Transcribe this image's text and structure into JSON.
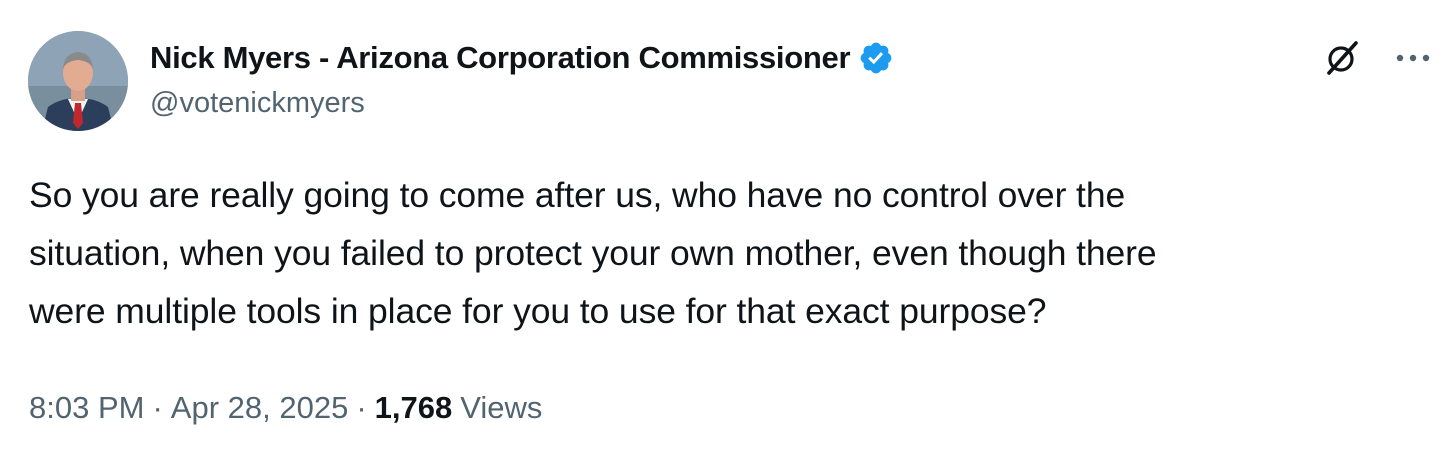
{
  "author": {
    "display_name": "Nick Myers - Arizona Corporation Commissioner",
    "handle": "@votenickmyers",
    "verified_icon": "verified-badge-icon",
    "verified_color": "#1d9bf0"
  },
  "actions": {
    "grok_icon": "grok-icon",
    "more_icon": "more-icon"
  },
  "tweet": {
    "text_lines": [
      "So you are really going to come after us, who have no control over the",
      "situation, when you failed to protect your own mother, even though there",
      "were multiple tools in place for you to use for that exact purpose?"
    ]
  },
  "meta": {
    "time": "8:03 PM",
    "separator": "·",
    "date": "Apr 28, 2025",
    "views_count": "1,768",
    "views_label": "Views"
  },
  "colors": {
    "text_primary": "#0f1419",
    "text_secondary": "#536471",
    "background": "#ffffff"
  }
}
